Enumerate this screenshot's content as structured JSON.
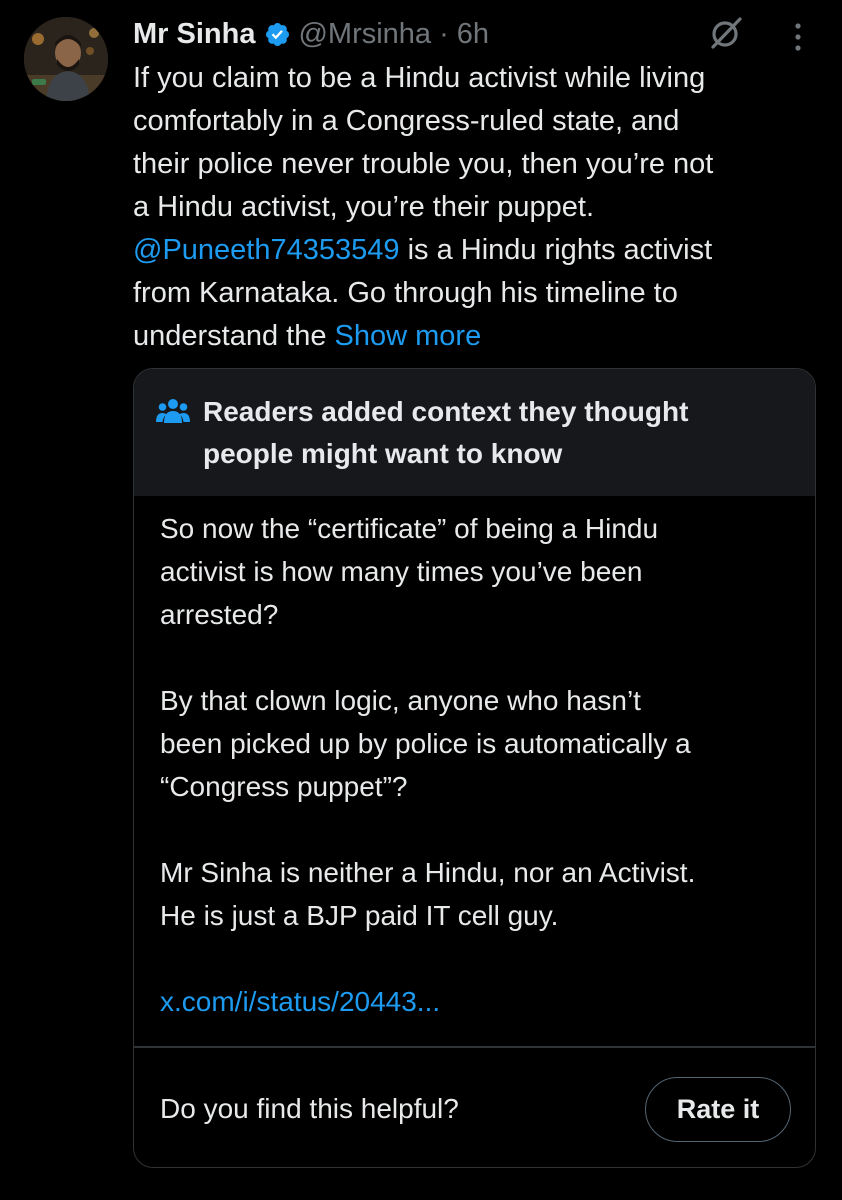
{
  "tweet": {
    "author_name": "Mr Sinha",
    "handle": "@Mrsinha",
    "separator": "·",
    "time": "6h",
    "text_lines": [
      "If you claim to be a Hindu activist while living",
      "comfortably in a Congress-ruled state, and",
      "their police never trouble you, then you’re not",
      "a Hindu activist, you’re their puppet."
    ],
    "mention": "@Puneeth74353549",
    "mention_after": " is a Hindu rights activist",
    "text_line_6": "from Karnataka. Go through his timeline to",
    "text_line_7": "understand the ",
    "show_more": "Show more"
  },
  "community_note": {
    "title_lines": [
      "Readers added context they thought",
      "people might want to know"
    ],
    "paragraphs": [
      [
        "So now the “certificate” of being a Hindu",
        "activist is how many times you’ve been",
        "arrested?"
      ],
      [
        "By that clown logic, anyone who hasn’t",
        "been picked up by police is automatically a",
        "“Congress puppet”?"
      ],
      [
        "Mr Sinha is neither a Hindu, nor an Activist.",
        "He is just a BJP paid IT cell guy."
      ]
    ],
    "link": "x.com/i/status/20443...",
    "helpful_prompt": "Do you find this helpful?",
    "rate_button": "Rate it"
  },
  "icons": {
    "verified": "verified-badge-icon",
    "grok": "grok-icon",
    "more": "more-options-icon",
    "people": "people-icon"
  },
  "colors": {
    "background": "#000000",
    "text": "#e7e9ea",
    "secondary": "#71767b",
    "link": "#1d9bf0",
    "note_header_bg": "#16181c",
    "border": "#2f3336"
  }
}
